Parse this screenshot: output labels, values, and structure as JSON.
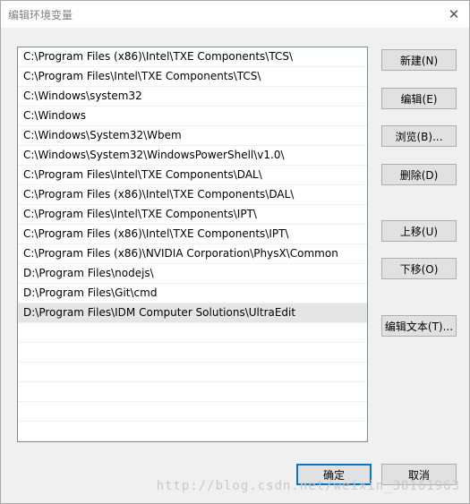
{
  "window": {
    "title": "编辑环境变量",
    "close_label": "✕"
  },
  "paths": [
    "C:\\Program Files (x86)\\Intel\\TXE Components\\TCS\\",
    "C:\\Program Files\\Intel\\TXE Components\\TCS\\",
    "C:\\Windows\\system32",
    "C:\\Windows",
    "C:\\Windows\\System32\\Wbem",
    "C:\\Windows\\System32\\WindowsPowerShell\\v1.0\\",
    "C:\\Program Files\\Intel\\TXE Components\\DAL\\",
    "C:\\Program Files (x86)\\Intel\\TXE Components\\DAL\\",
    "C:\\Program Files\\Intel\\TXE Components\\IPT\\",
    "C:\\Program Files (x86)\\Intel\\TXE Components\\IPT\\",
    "C:\\Program Files (x86)\\NVIDIA Corporation\\PhysX\\Common",
    "D:\\Program Files\\nodejs\\",
    "D:\\Program Files\\Git\\cmd",
    "D:\\Program Files\\IDM Computer Solutions\\UltraEdit"
  ],
  "buttons": {
    "new": "新建(N)",
    "edit": "编辑(E)",
    "browse": "浏览(B)...",
    "delete": "删除(D)",
    "move_up": "上移(U)",
    "move_down": "下移(O)",
    "edit_text": "编辑文本(T)...",
    "ok": "确定",
    "cancel": "取消"
  },
  "watermark": "http://blog.csdn.net/weixin_38161963"
}
